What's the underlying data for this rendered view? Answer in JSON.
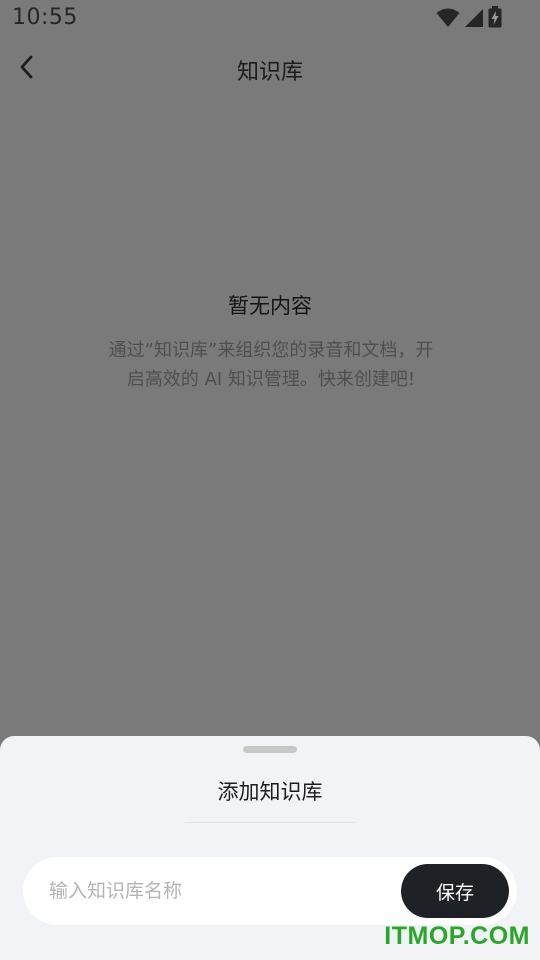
{
  "status_bar": {
    "time": "10:55",
    "icons": [
      "wifi-icon",
      "signal-icon",
      "battery-charging-icon"
    ]
  },
  "app_bar": {
    "back_icon": "chevron-left-icon",
    "title": "知识库"
  },
  "empty_state": {
    "title": "暂无内容",
    "description": "通过“知识库”来组织您的录音和文档，开启高效的 AI 知识管理。快来创建吧!"
  },
  "sheet": {
    "title": "添加知识库",
    "input": {
      "value": "",
      "placeholder": "输入知识库名称"
    },
    "save_label": "保存"
  },
  "watermark": "ITMOP.COM",
  "colors": {
    "overlay": "#7a7a7a",
    "sheet_bg": "#f2f3f7",
    "save_button_bg": "#1e2126",
    "watermark": "#2aa72a"
  }
}
